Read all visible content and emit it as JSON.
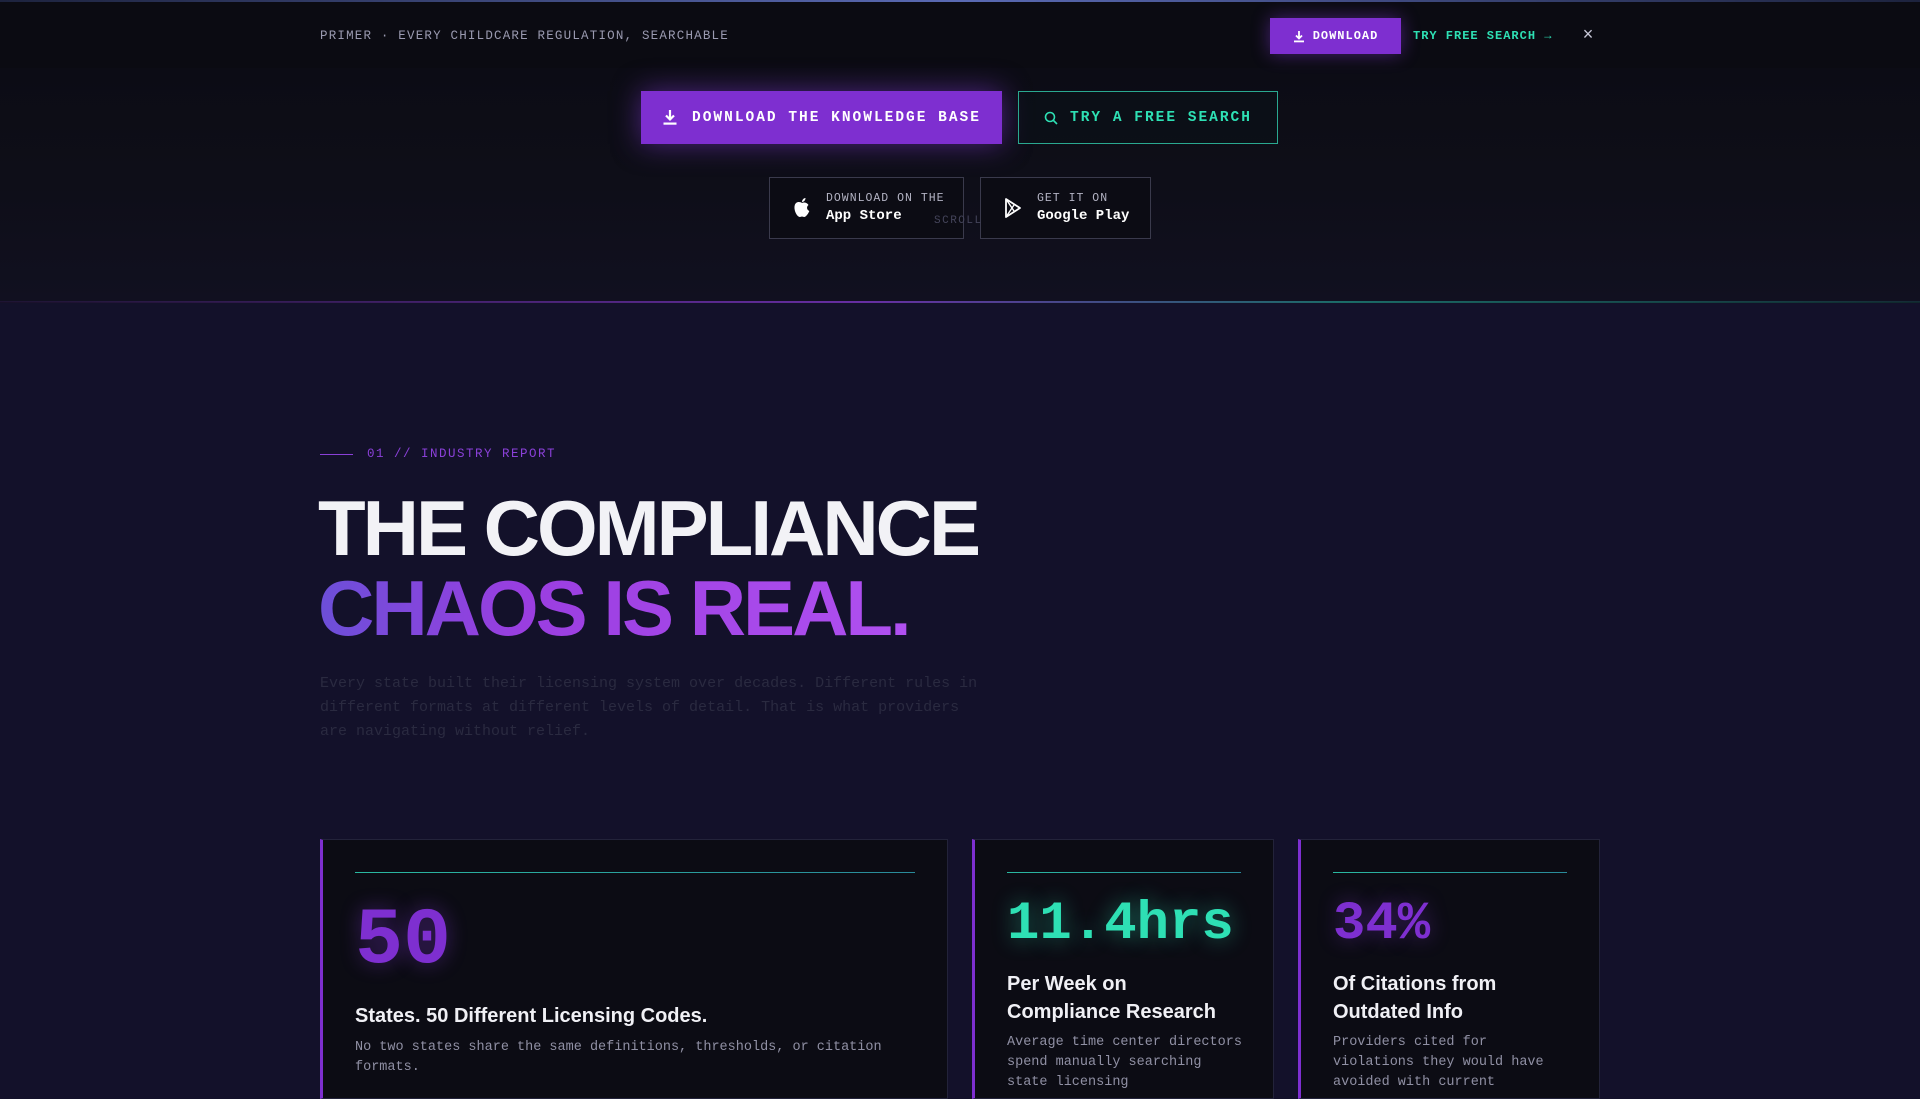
{
  "banner": {
    "text": "PRIMER · EVERY CHILDCARE REGULATION, SEARCHABLE",
    "download_label": "DOWNLOAD",
    "search_label": "TRY FREE SEARCH →",
    "close_glyph": "×"
  },
  "hero": {
    "primary_cta": "DOWNLOAD THE KNOWLEDGE BASE",
    "secondary_cta": "TRY A FREE SEARCH",
    "app_store": {
      "small": "DOWNLOAD ON THE",
      "big": "App Store"
    },
    "google_play": {
      "small": "GET IT ON",
      "big": "Google Play"
    },
    "scroll_hint": "SCROLL"
  },
  "section": {
    "label": "01 // INDUSTRY REPORT",
    "headline_line1": "THE COMPLIANCE",
    "headline_line2": "CHAOS IS REAL.",
    "paragraph": "Every state built their licensing system over decades. Different rules in different formats at different levels of detail. That is what providers are navigating without relief."
  },
  "stats": [
    {
      "value": "50",
      "title": "States. 50 Different Licensing Codes.",
      "desc": "No two states share the same definitions, thresholds, or citation formats.",
      "color": "#7e2fd0"
    },
    {
      "value": "11.4hrs",
      "title": "Per Week on Compliance Research",
      "desc": "Average time center directors spend manually searching state licensing",
      "color": "#2ee0b4"
    },
    {
      "value": "34%",
      "title": "Of Citations from Outdated Info",
      "desc": "Providers cited for violations they would have avoided with current",
      "color": "#7e2fd0"
    }
  ],
  "colors": {
    "accent_purple": "#7e2fd0",
    "accent_teal": "#2ee0b4",
    "background": "#13112a"
  },
  "icons": [
    "download-icon",
    "search-icon",
    "apple-icon",
    "google-play-icon",
    "close-icon"
  ]
}
